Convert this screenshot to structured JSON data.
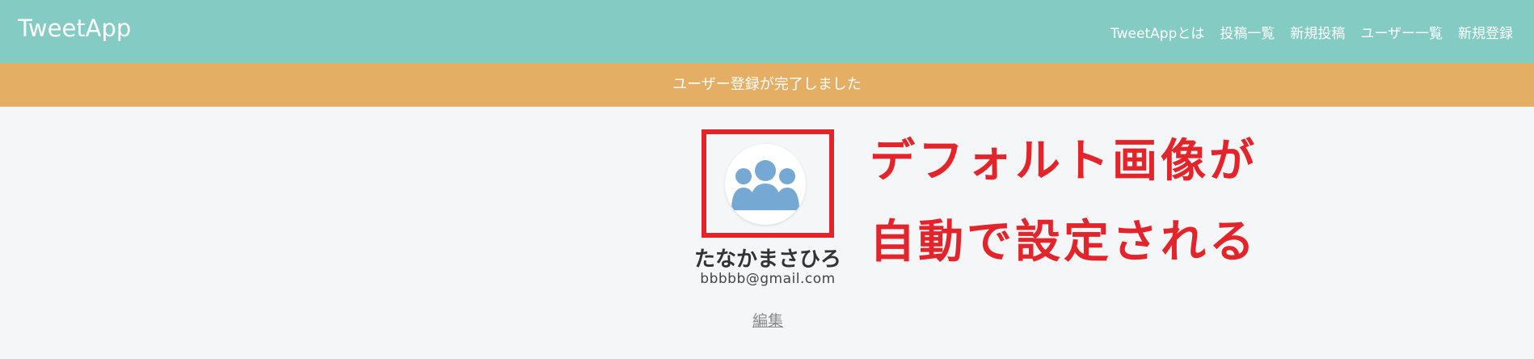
{
  "header": {
    "logo": "TweetApp",
    "nav": [
      {
        "label": "TweetAppとは",
        "name": "nav-about"
      },
      {
        "label": "投稿一覧",
        "name": "nav-posts"
      },
      {
        "label": "新規投稿",
        "name": "nav-new-post"
      },
      {
        "label": "ユーザー一覧",
        "name": "nav-users"
      },
      {
        "label": "新規登録",
        "name": "nav-signup"
      }
    ]
  },
  "flash": {
    "message": "ユーザー登録が完了しました"
  },
  "profile": {
    "avatar_icon": "default-user-group-icon",
    "name": "たなかまさひろ",
    "email": "bbbbb@gmail.com",
    "edit_label": "編集"
  },
  "annotation": {
    "line1": "デフォルト画像が",
    "line2": "自動で設定される",
    "color": "#e3242b"
  },
  "colors": {
    "header_bg": "#83cbc3",
    "flash_bg": "#e4af64",
    "page_bg": "#f5f6f8",
    "avatar_fill": "#75a8d3"
  }
}
